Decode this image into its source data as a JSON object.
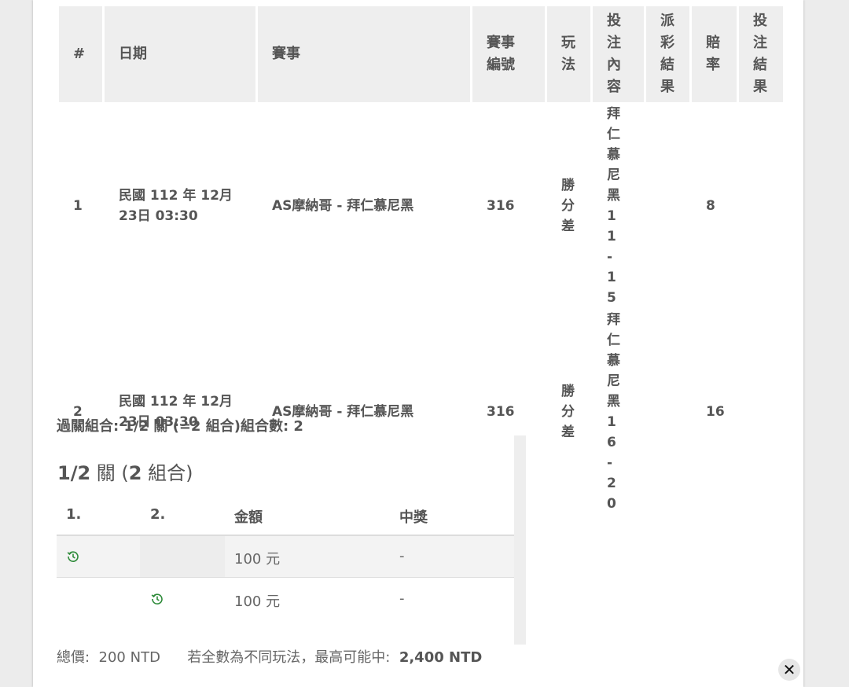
{
  "bets_table": {
    "headers": [
      "#",
      "日期",
      "賽事",
      "賽事編號",
      "玩法",
      "投注內容",
      "派彩結果",
      "賠率",
      "投注結果"
    ],
    "rows": [
      {
        "index": "1",
        "date_line1": "民國 112 年 12月",
        "date_line2": "23日 03:30",
        "match": "AS摩納哥 - 拜仁慕尼黑",
        "match_no": "316",
        "play": "勝分差",
        "bet_content": "拜仁慕尼黑11-15",
        "payout": "",
        "odds": "8",
        "result": ""
      },
      {
        "index": "2",
        "date_line1": "民國 112 年 12月",
        "date_line2": "23日 03:30",
        "match": "AS摩納哥 - 拜仁慕尼黑",
        "match_no": "316",
        "play": "勝分差",
        "bet_content": "拜仁慕尼黑16-20",
        "payout": "",
        "odds": "16",
        "result": ""
      }
    ]
  },
  "combo": {
    "summary": "過關組合: 1/2 關 (=2 組合)組合數: 2",
    "title_bold1": "1/2",
    "title_mid": " 關 (",
    "title_bold2": "2",
    "title_end": " 組合)",
    "headers": [
      "1.",
      "2.",
      "金額",
      "中獎"
    ],
    "rows": [
      {
        "amount": "100 元",
        "prize": "-"
      },
      {
        "amount": "100 元",
        "prize": "-"
      }
    ]
  },
  "footer": {
    "total_label": "總價:",
    "total_value": "200 NTD",
    "max_label": "若全數為不同玩法，最高可能中:",
    "max_value": "2,400 NTD"
  },
  "icons": {
    "pending": "clock-history-icon",
    "close": "close-icon"
  },
  "colors": {
    "pending_icon": "#2e8b3a",
    "header_bg": "#eeeeee"
  },
  "close_glyph": "✕"
}
